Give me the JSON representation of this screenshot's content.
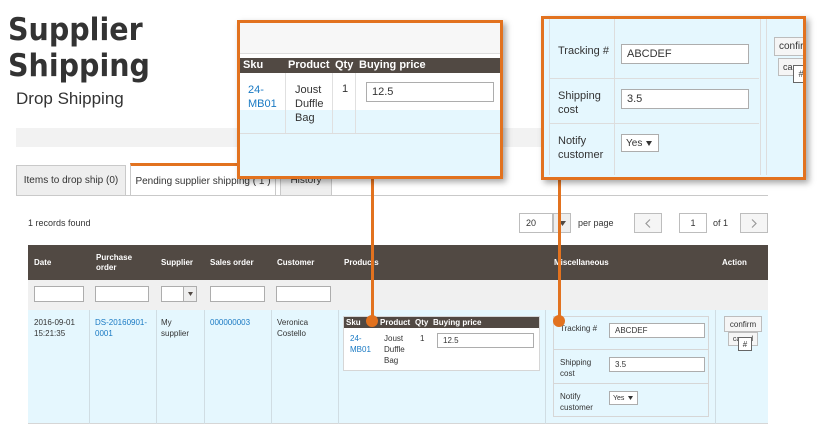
{
  "header": {
    "title_line1": "Supplier",
    "title_line2": "Shipping",
    "subtitle": "Drop Shipping"
  },
  "tabs": [
    {
      "label": "Items to drop ship (0)",
      "active": false
    },
    {
      "label": "Pending supplier shipping ( 1 )",
      "active": true
    },
    {
      "label": "History",
      "active": false
    }
  ],
  "toolbar": {
    "records_found": "1 records found",
    "per_page_value": "20",
    "per_page_label": "per page",
    "page_value": "1",
    "of_pages": "of 1",
    "prev_icon": "chevron-left-icon",
    "next_icon": "chevron-right-icon"
  },
  "grid": {
    "columns": [
      "Date",
      "Purchase order",
      "Supplier",
      "Sales order",
      "Customer",
      "Products",
      "Miscellaneous",
      "Action"
    ],
    "rows": [
      {
        "date": "2016-09-01 15:21:35",
        "purchase_order": "DS-20160901-0001",
        "supplier": "My supplier",
        "sales_order": "000000003",
        "customer": "Veronica Costello",
        "products": {
          "columns": [
            "Sku",
            "Product",
            "Qty",
            "Buying price"
          ],
          "items": [
            {
              "sku": "24-MB01",
              "product": "Joust Duffle Bag",
              "qty": "1",
              "buying_price": "12.5"
            }
          ]
        },
        "misc": {
          "tracking_label": "Tracking #",
          "tracking_value": "ABCDEF",
          "shipping_cost_label": "Shipping cost",
          "shipping_cost_value": "3.5",
          "notify_label": "Notify customer",
          "notify_value": "Yes"
        },
        "actions": {
          "confirm": "confirm",
          "cancel": "cancel",
          "cursor_label": "#"
        }
      }
    ]
  },
  "zoom_products": {
    "columns": [
      "Sku",
      "Product",
      "Qty",
      "Buying price"
    ],
    "sku": "24-MB01",
    "product": "Joust Duffle Bag",
    "qty": "1",
    "buying_price": "12.5"
  },
  "zoom_misc": {
    "tracking_label": "Tracking #",
    "tracking_value": "ABCDEF",
    "shipping_cost_label": "Shipping cost",
    "shipping_cost_value": "3.5",
    "notify_label": "Notify customer",
    "notify_value": "Yes",
    "confirm": "confirm",
    "cancel": "cancel",
    "cursor_label": "#"
  },
  "colors": {
    "accent": "#e2721f",
    "header_bg": "#514943",
    "row_bg": "#e5f7fe",
    "link": "#1979c3"
  }
}
